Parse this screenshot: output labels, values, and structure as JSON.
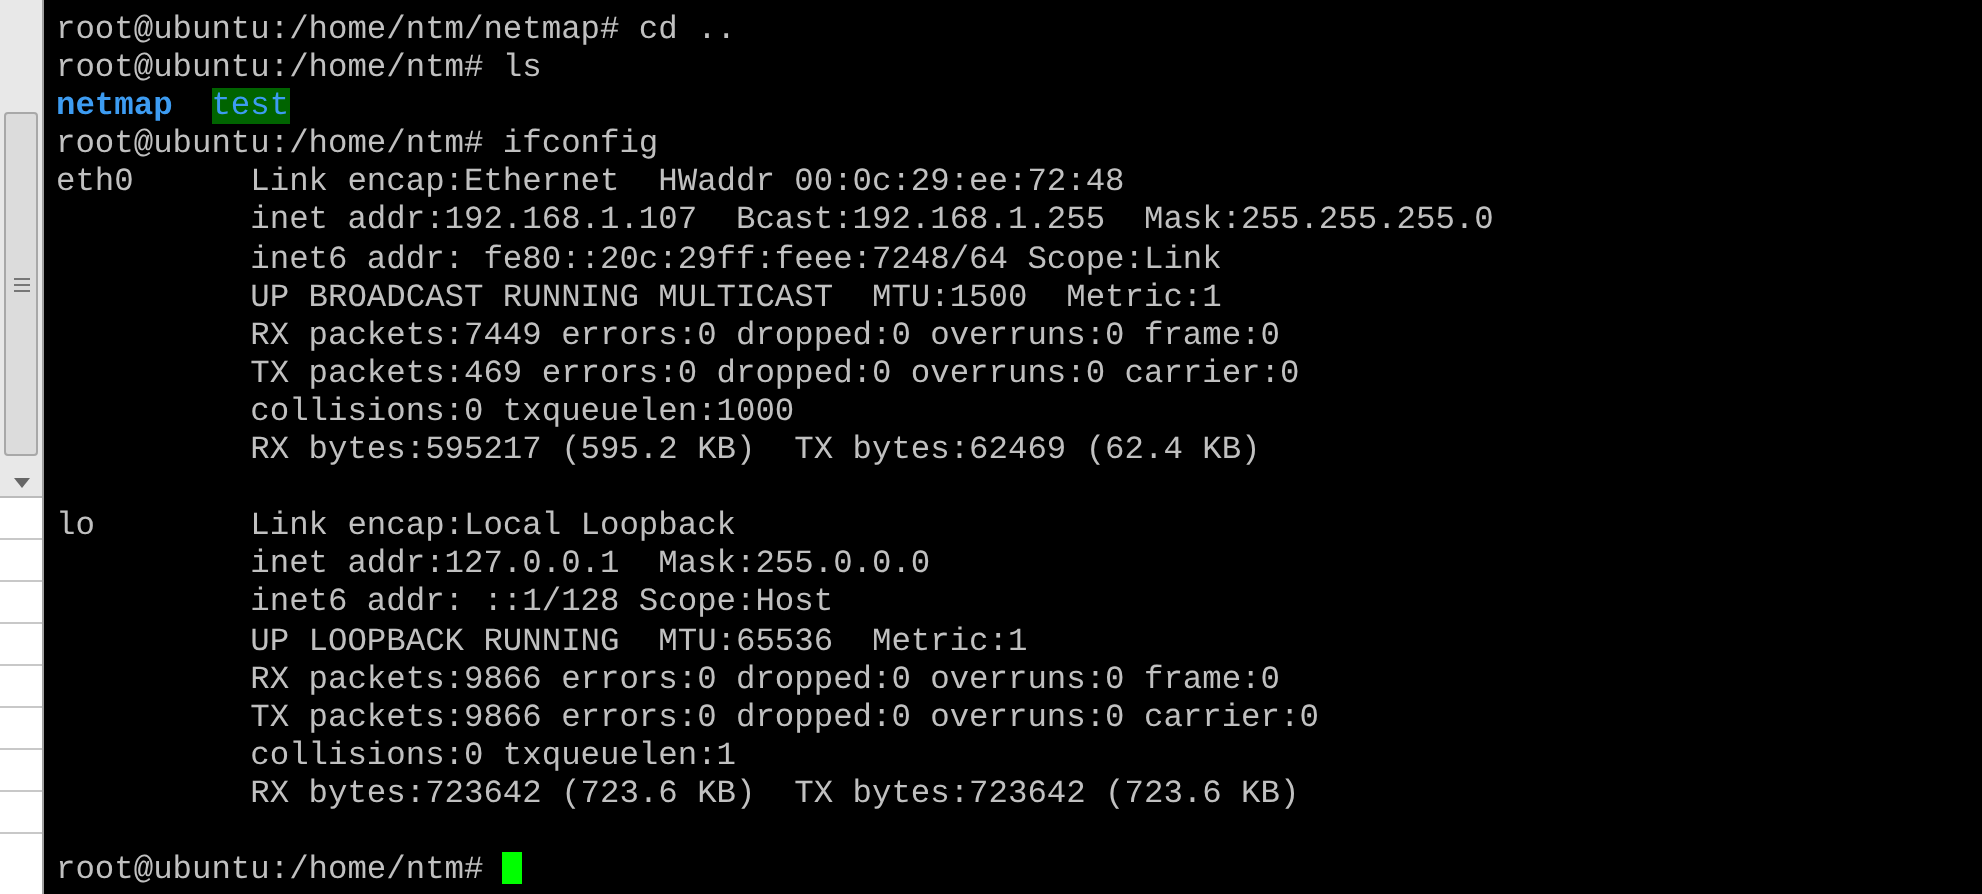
{
  "terminal": {
    "lines": [
      {
        "kind": "text",
        "text": "root@ubuntu:/home/ntm/netmap# cd .."
      },
      {
        "kind": "text",
        "text": "root@ubuntu:/home/ntm# ls"
      },
      {
        "kind": "listing",
        "entries": [
          {
            "name": "netmap",
            "highlighted": false
          },
          {
            "name": "test",
            "highlighted": true
          }
        ]
      },
      {
        "kind": "text",
        "text": "root@ubuntu:/home/ntm# ifconfig"
      },
      {
        "kind": "text",
        "text": "eth0      Link encap:Ethernet  HWaddr 00:0c:29:ee:72:48"
      },
      {
        "kind": "text",
        "text": "          inet addr:192.168.1.107  Bcast:192.168.1.255  Mask:255.255.255.0"
      },
      {
        "kind": "text",
        "text": "          inet6 addr: fe80::20c:29ff:feee:7248/64 Scope:Link"
      },
      {
        "kind": "text",
        "text": "          UP BROADCAST RUNNING MULTICAST  MTU:1500  Metric:1"
      },
      {
        "kind": "text",
        "text": "          RX packets:7449 errors:0 dropped:0 overruns:0 frame:0"
      },
      {
        "kind": "text",
        "text": "          TX packets:469 errors:0 dropped:0 overruns:0 carrier:0"
      },
      {
        "kind": "text",
        "text": "          collisions:0 txqueuelen:1000"
      },
      {
        "kind": "text",
        "text": "          RX bytes:595217 (595.2 KB)  TX bytes:62469 (62.4 KB)"
      },
      {
        "kind": "blank"
      },
      {
        "kind": "text",
        "text": "lo        Link encap:Local Loopback"
      },
      {
        "kind": "text",
        "text": "          inet addr:127.0.0.1  Mask:255.0.0.0"
      },
      {
        "kind": "text",
        "text": "          inet6 addr: ::1/128 Scope:Host"
      },
      {
        "kind": "text",
        "text": "          UP LOOPBACK RUNNING  MTU:65536  Metric:1"
      },
      {
        "kind": "text",
        "text": "          RX packets:9866 errors:0 dropped:0 overruns:0 frame:0"
      },
      {
        "kind": "text",
        "text": "          TX packets:9866 errors:0 dropped:0 overruns:0 carrier:0"
      },
      {
        "kind": "text",
        "text": "          collisions:0 txqueuelen:1"
      },
      {
        "kind": "text",
        "text": "          RX bytes:723642 (723.6 KB)  TX bytes:723642 (723.6 KB)"
      },
      {
        "kind": "blank"
      },
      {
        "kind": "prompt",
        "text": "root@ubuntu:/home/ntm#",
        "cursor": true
      }
    ]
  }
}
